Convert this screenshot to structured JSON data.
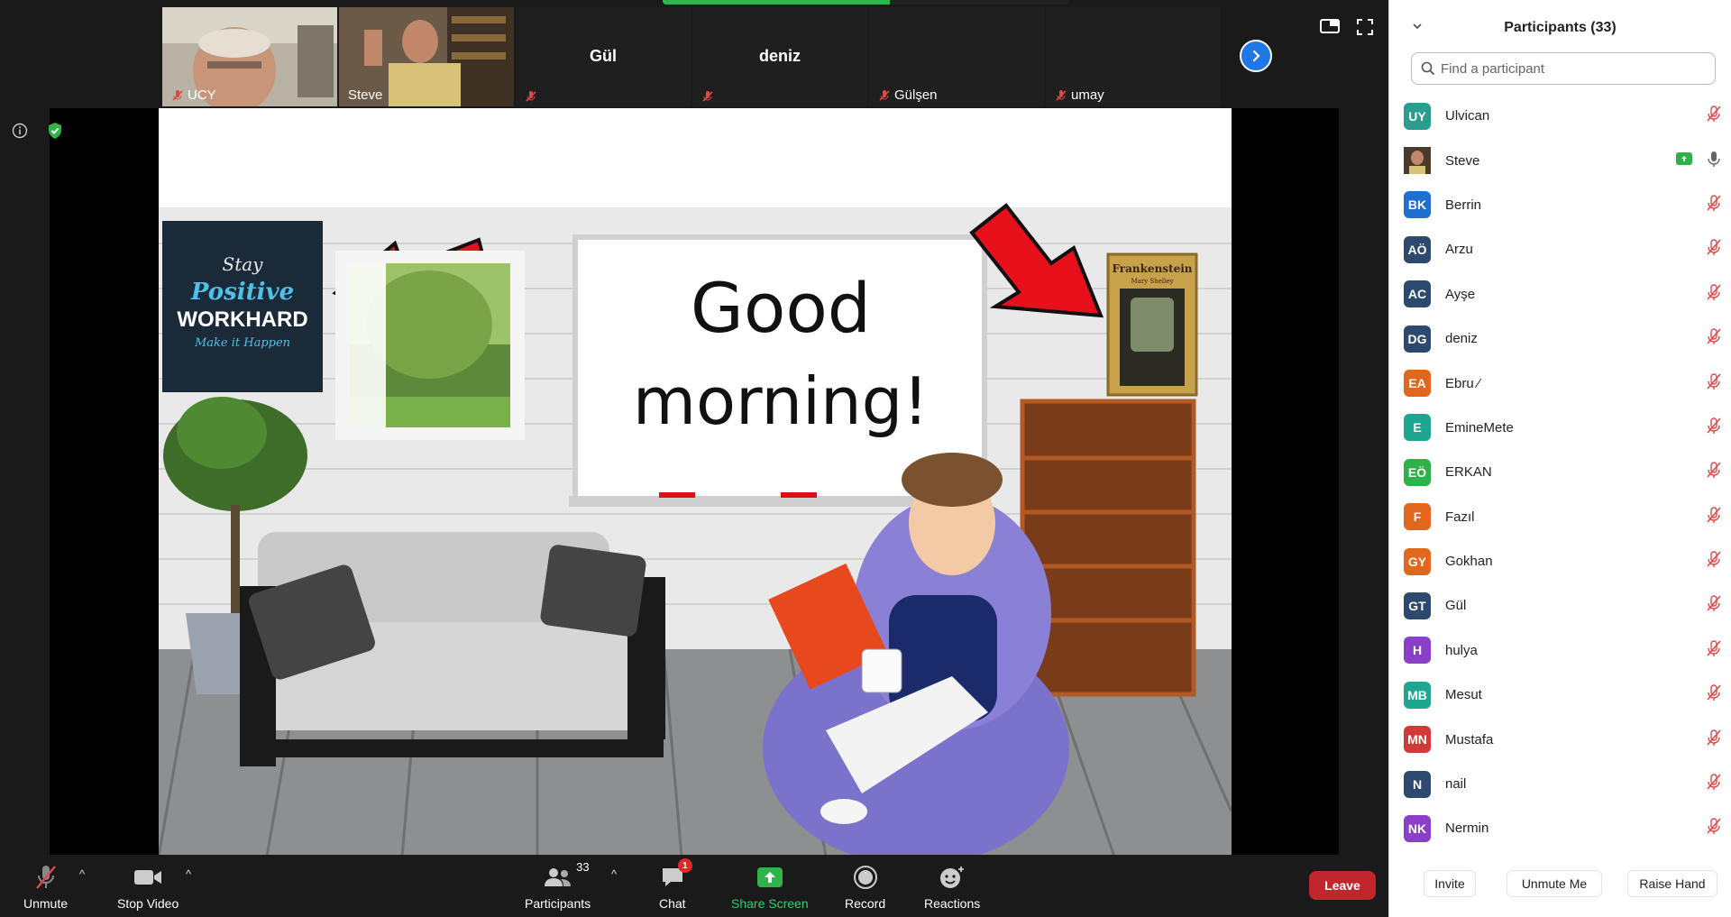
{
  "meeting": {
    "share_progress": 0.56,
    "thumbnails": [
      {
        "name": "UCY",
        "type": "video",
        "muted": true
      },
      {
        "name": "Steve",
        "type": "video",
        "muted": false,
        "active": true
      },
      {
        "name": "Gül",
        "type": "name",
        "muted": true
      },
      {
        "name": "deniz",
        "type": "name",
        "muted": true
      },
      {
        "name": "Gülşen",
        "type": "nameonly",
        "muted": true
      },
      {
        "name": "umay",
        "type": "nameonly",
        "muted": true
      }
    ],
    "icons": {
      "next_page": "chevron-right-icon",
      "view": "view-toggle-icon",
      "fullscreen": "fullscreen-icon",
      "info": "info-icon",
      "encryption": "shield-check-icon"
    },
    "shared_screen": {
      "greeting_line1": "Good",
      "greeting_line2": "morning!",
      "poster_line1": "Stay",
      "poster_line2": "Positive",
      "poster_line3": "WORKHARD",
      "poster_line4": "Make it Happen",
      "book_title": "Frankenstein",
      "book_author": "Mary Shelley"
    }
  },
  "toolbar": {
    "unmute": "Unmute",
    "stop_video": "Stop Video",
    "participants": "Participants",
    "participants_count": "33",
    "chat": "Chat",
    "chat_badge": "1",
    "share_screen": "Share Screen",
    "record": "Record",
    "reactions": "Reactions",
    "leave": "Leave",
    "colors": {
      "share": "#2fd06b",
      "leave": "#c0262c"
    }
  },
  "panel": {
    "title": "Participants (33)",
    "search_placeholder": "Find a participant",
    "participants": [
      {
        "initials": "UY",
        "name": "Ulvican",
        "color": "#2a9d8f",
        "mic": "muted"
      },
      {
        "initials": "",
        "name": "Steve",
        "color": "#6b5040",
        "mic": "on",
        "sharing": true,
        "photo": true
      },
      {
        "initials": "BK",
        "name": " Berrin",
        "color": "#1e6fd0",
        "mic": "muted"
      },
      {
        "initials": "AÖ",
        "name": "Arzu",
        "color": "#2d4a6e",
        "mic": "muted"
      },
      {
        "initials": "AC",
        "name": "Ayşe",
        "color": "#2d4a6e",
        "mic": "muted"
      },
      {
        "initials": "DG",
        "name": "deniz",
        "color": "#2d4a6e",
        "mic": "muted"
      },
      {
        "initials": "EA",
        "name": "Ebru ⁄",
        "color": "#e0671d",
        "mic": "muted"
      },
      {
        "initials": "E",
        "name": "EmineMete",
        "color": "#1fa690",
        "mic": "muted"
      },
      {
        "initials": "EÖ",
        "name": "ERKAN",
        "color": "#2bb34a",
        "mic": "muted"
      },
      {
        "initials": "F",
        "name": "Fazıl",
        "color": "#e0671d",
        "mic": "muted"
      },
      {
        "initials": "GY",
        "name": "Gokhan",
        "color": "#e0671d",
        "mic": "muted"
      },
      {
        "initials": "GT",
        "name": "Gül",
        "color": "#2d4a6e",
        "mic": "muted"
      },
      {
        "initials": "H",
        "name": "hulya",
        "color": "#8a3fc7",
        "mic": "muted"
      },
      {
        "initials": "MB",
        "name": "Mesut",
        "color": "#1fa690",
        "mic": "muted"
      },
      {
        "initials": "MN",
        "name": "Mustafa",
        "color": "#d23a3a",
        "mic": "muted"
      },
      {
        "initials": "N",
        "name": "nail",
        "color": "#2d4a6e",
        "mic": "muted"
      },
      {
        "initials": "NK",
        "name": "Nermin",
        "color": "#8a3fc7",
        "mic": "muted"
      }
    ],
    "footer": {
      "invite": "Invite",
      "unmute_me": "Unmute Me",
      "raise_hand": "Raise Hand"
    }
  }
}
